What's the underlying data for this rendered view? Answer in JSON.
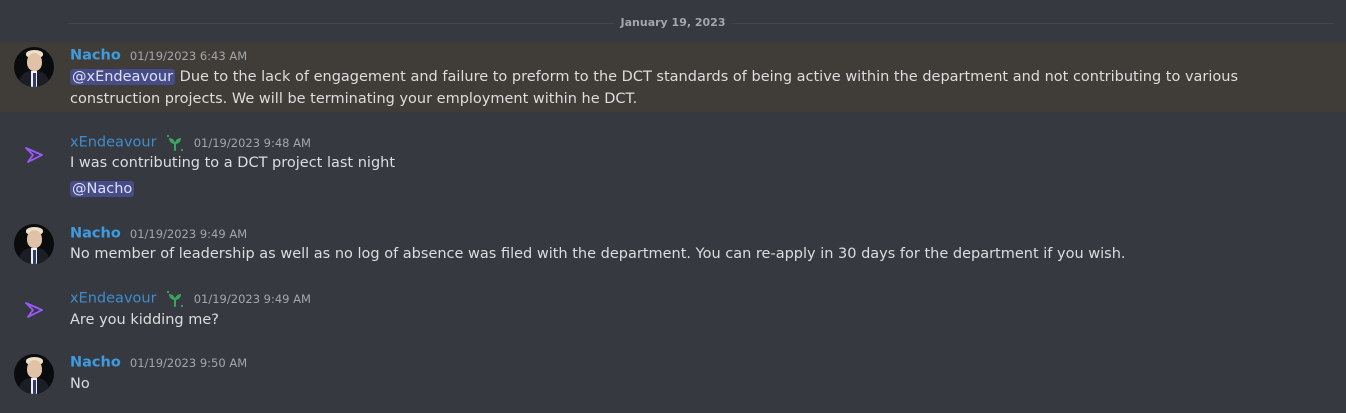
{
  "channel": {
    "date_divider": "January 19, 2023"
  },
  "messages": [
    {
      "author": "Nacho",
      "timestamp": "01/19/2023 6:43 AM",
      "mention": "@xEndeavour",
      "text": "Due to the lack of engagement and failure to preform to the DCT standards of being active within the department and not contributing to various construction projects. We will be terminating your employment within he DCT.",
      "highlighted": true,
      "avatar": "portrait-avatar"
    },
    {
      "author": "xEndeavour",
      "timestamp": "01/19/2023 9:48 AM",
      "text": "I was contributing to a DCT project last night",
      "mention": "@Nacho",
      "badge": "sprout-badge-icon",
      "avatar": "purple-arrow-logo"
    },
    {
      "author": "Nacho",
      "timestamp": "01/19/2023 9:49 AM",
      "text": "No member of leadership as well as no log of absence was filed with the department. You can re-apply in 30 days for the department if you wish.",
      "avatar": "portrait-avatar"
    },
    {
      "author": "xEndeavour",
      "timestamp": "01/19/2023 9:49 AM",
      "text": "Are you kidding me?",
      "badge": "sprout-badge-icon",
      "avatar": "purple-arrow-logo"
    },
    {
      "author": "Nacho",
      "timestamp": "01/19/2023 9:50 AM",
      "text": "No",
      "avatar": "portrait-avatar"
    }
  ],
  "colors": {
    "background": "#36393f",
    "highlight": "#403d38",
    "username_nacho": "#3e9be0",
    "username_xendeavour": "#3f8ccc",
    "mention_bg": "#454c88",
    "badge_green": "#3ba55c",
    "logo_purple": "#9b59ff"
  }
}
